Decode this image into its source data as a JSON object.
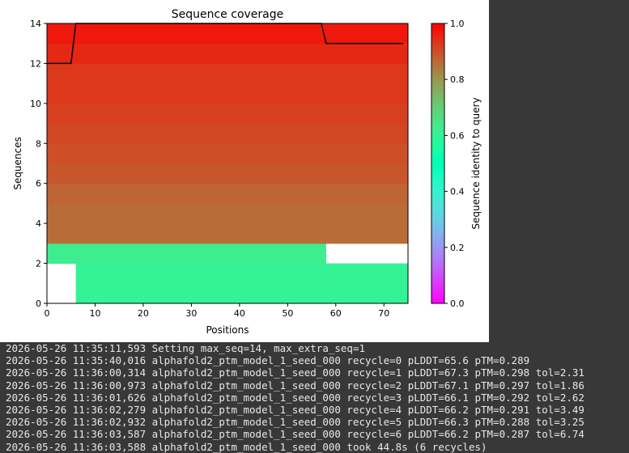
{
  "chart_data": {
    "type": "heatmap",
    "title": "Sequence coverage",
    "xlabel": "Positions",
    "ylabel": "Sequences",
    "xlim": [
      0,
      75
    ],
    "ylim": [
      0,
      14
    ],
    "xticks": [
      "0",
      "10",
      "20",
      "30",
      "40",
      "50",
      "60",
      "70"
    ],
    "yticks": [
      "0",
      "2",
      "4",
      "6",
      "8",
      "10",
      "12",
      "14"
    ],
    "colorbar": {
      "label": "Sequence identity to query",
      "ticks": [
        "0.0",
        "0.2",
        "0.4",
        "0.6",
        "0.8",
        "1.0"
      ],
      "colormap": "rainbow"
    },
    "rows": [
      {
        "seq": 0,
        "segments": [
          {
            "x0": 6,
            "x1": 75,
            "identity": 0.6
          }
        ]
      },
      {
        "seq": 1,
        "segments": [
          {
            "x0": 6,
            "x1": 75,
            "identity": 0.6
          }
        ]
      },
      {
        "seq": 2,
        "segments": [
          {
            "x0": 0,
            "x1": 58,
            "identity": 0.62
          }
        ]
      },
      {
        "seq": 3,
        "segments": [
          {
            "x0": 0,
            "x1": 75,
            "identity": 0.86
          }
        ]
      },
      {
        "seq": 4,
        "segments": [
          {
            "x0": 0,
            "x1": 75,
            "identity": 0.86
          }
        ]
      },
      {
        "seq": 5,
        "segments": [
          {
            "x0": 0,
            "x1": 75,
            "identity": 0.87
          }
        ]
      },
      {
        "seq": 6,
        "segments": [
          {
            "x0": 0,
            "x1": 75,
            "identity": 0.89
          }
        ]
      },
      {
        "seq": 7,
        "segments": [
          {
            "x0": 0,
            "x1": 75,
            "identity": 0.9
          }
        ]
      },
      {
        "seq": 8,
        "segments": [
          {
            "x0": 0,
            "x1": 75,
            "identity": 0.91
          }
        ]
      },
      {
        "seq": 9,
        "segments": [
          {
            "x0": 0,
            "x1": 75,
            "identity": 0.92
          }
        ]
      },
      {
        "seq": 10,
        "segments": [
          {
            "x0": 0,
            "x1": 75,
            "identity": 0.93
          }
        ]
      },
      {
        "seq": 11,
        "segments": [
          {
            "x0": 0,
            "x1": 75,
            "identity": 0.93
          }
        ]
      },
      {
        "seq": 12,
        "segments": [
          {
            "x0": 0,
            "x1": 75,
            "identity": 0.95
          }
        ]
      },
      {
        "seq": 13,
        "segments": [
          {
            "x0": 0,
            "x1": 75,
            "identity": 0.97
          }
        ]
      }
    ],
    "coverage_line": {
      "x": [
        0,
        5,
        6,
        57,
        58,
        74
      ],
      "y": [
        12.0,
        12.0,
        14.0,
        14.0,
        13.0,
        13.0
      ]
    }
  },
  "log": {
    "lines": [
      "2026-05-26 11:35:11,593 Setting max_seq=14, max_extra_seq=1",
      "2026-05-26 11:35:40,016 alphafold2_ptm_model_1_seed_000 recycle=0 pLDDT=65.6 pTM=0.289",
      "2026-05-26 11:36:00,314 alphafold2_ptm_model_1_seed_000 recycle=1 pLDDT=67.3 pTM=0.298 tol=2.31",
      "2026-05-26 11:36:00,973 alphafold2_ptm_model_1_seed_000 recycle=2 pLDDT=67.1 pTM=0.297 tol=1.86",
      "2026-05-26 11:36:01,626 alphafold2_ptm_model_1_seed_000 recycle=3 pLDDT=66.1 pTM=0.292 tol=2.62",
      "2026-05-26 11:36:02,279 alphafold2_ptm_model_1_seed_000 recycle=4 pLDDT=66.2 pTM=0.291 tol=3.49",
      "2026-05-26 11:36:02,932 alphafold2_ptm_model_1_seed_000 recycle=5 pLDDT=66.3 pTM=0.288 tol=3.25",
      "2026-05-26 11:36:03,587 alphafold2_ptm_model_1_seed_000 recycle=6 pLDDT=66.2 pTM=0.287 tol=6.74",
      "2026-05-26 11:36:03,588 alphafold2_ptm_model_1_seed_000 took 44.8s (6 recycles)"
    ]
  }
}
